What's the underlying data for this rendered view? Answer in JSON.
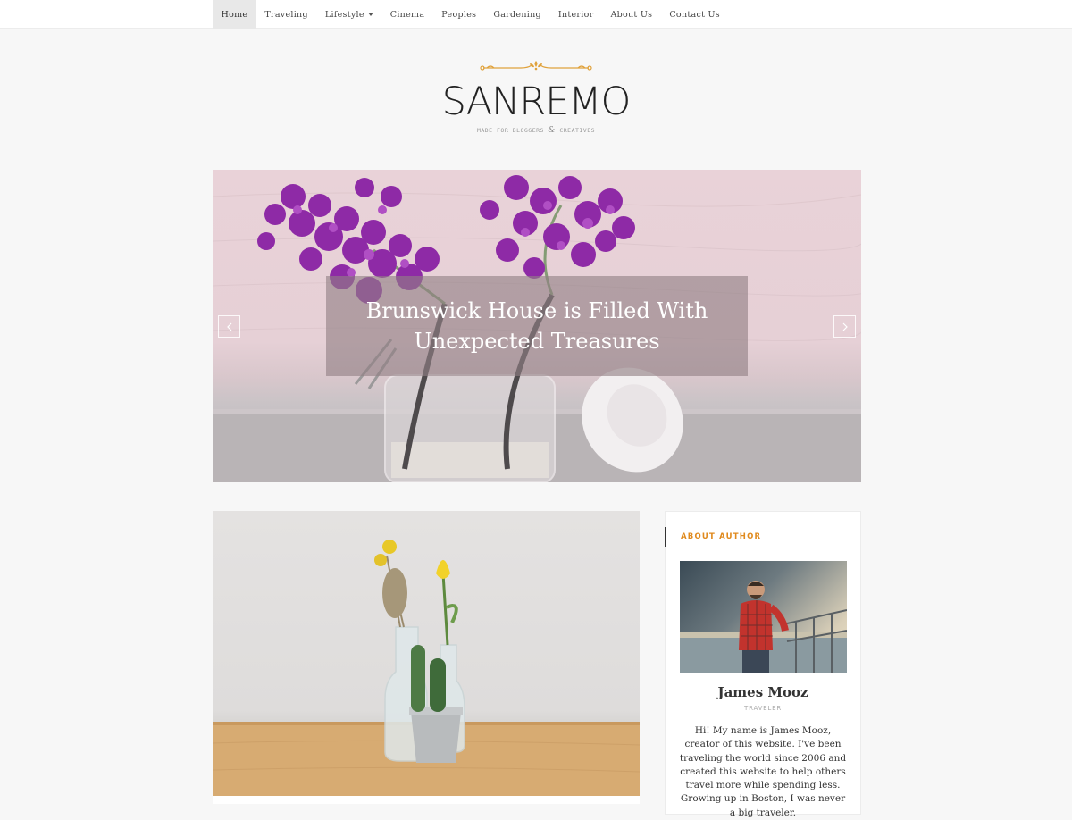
{
  "nav": {
    "items": [
      {
        "label": "Home",
        "active": true
      },
      {
        "label": "Traveling"
      },
      {
        "label": "Lifestyle",
        "dropdown": true
      },
      {
        "label": "Cinema"
      },
      {
        "label": "Peoples"
      },
      {
        "label": "Gardening"
      },
      {
        "label": "Interior"
      },
      {
        "label": "About Us"
      },
      {
        "label": "Contact Us"
      }
    ]
  },
  "brand": {
    "title": "SANREMO",
    "tagline_left": "MADE FOR BLOGGERS",
    "tagline_amp": "&",
    "tagline_right": "CREATIVES",
    "ornament_color": "#e0a23c"
  },
  "slider": {
    "slide_title": "Brunswick House is Filled With Unexpected Treasures",
    "prev_icon": "chevron-left-icon",
    "next_icon": "chevron-right-icon"
  },
  "sidebar": {
    "widget_title": "ABOUT AUTHOR",
    "author_name": "James Mooz",
    "author_role": "TRAVELER",
    "author_bio": "Hi! My name is James Mooz, creator of this website. I've been traveling the world since 2006 and created this website to help others travel more while spending less. Growing up in Boston, I was never a big traveler.",
    "accent_color": "#e08a1e"
  }
}
